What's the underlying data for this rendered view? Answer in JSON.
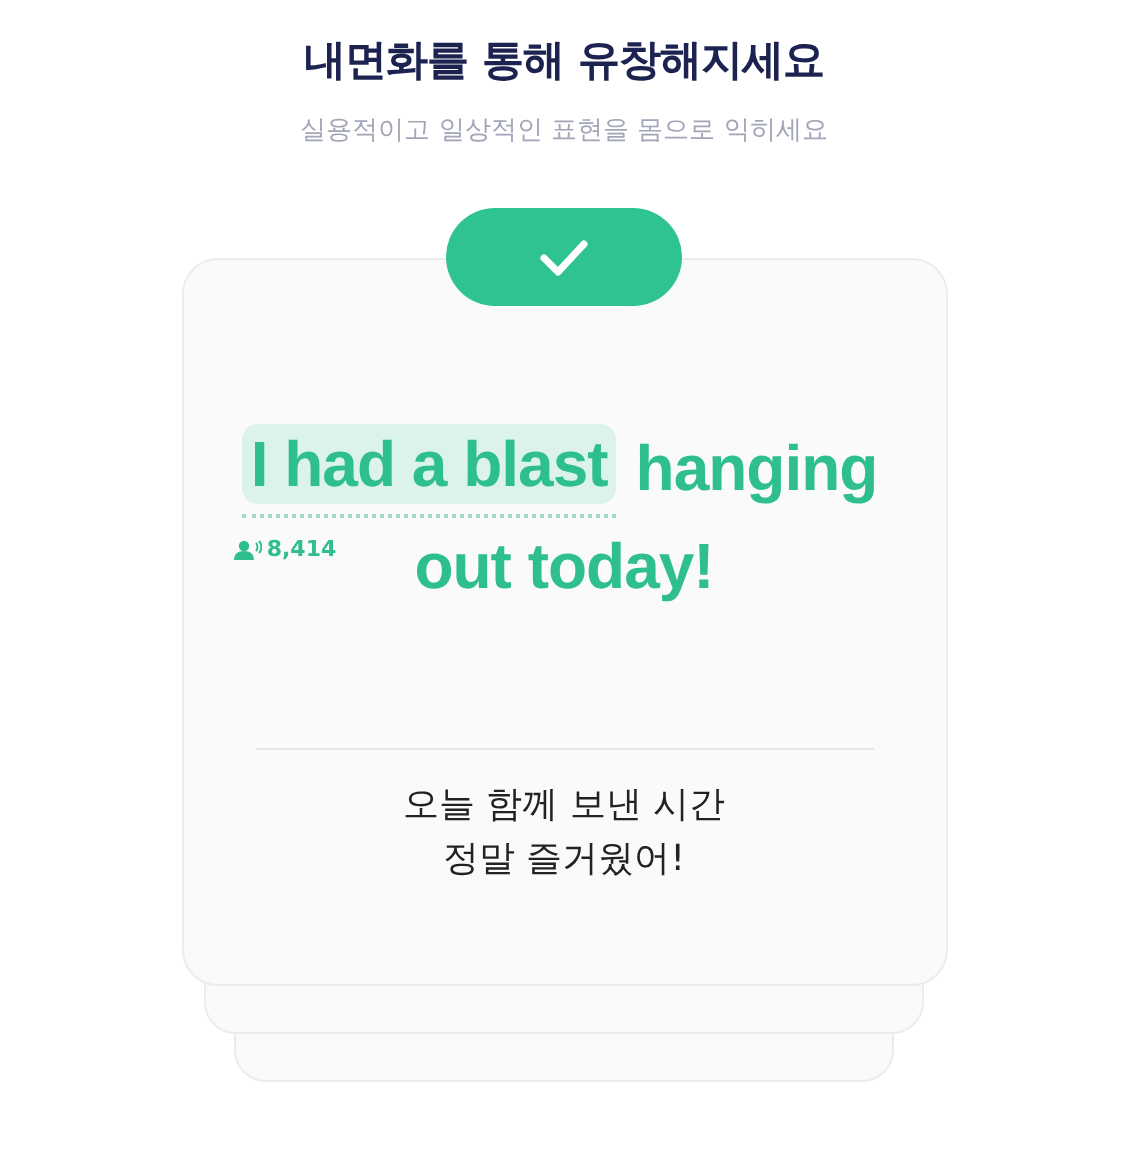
{
  "header": {
    "title": "내면화를 통해 유창해지세요",
    "subtitle": "실용적이고 일상적인 표현을 몸으로 익히세요"
  },
  "card": {
    "completed": true,
    "phrase_lines": [
      [
        {
          "text": "I had a blast",
          "highlighted": true,
          "learners": "8,414"
        },
        {
          "text": "hanging",
          "highlighted": false
        }
      ],
      [
        {
          "text": "out today!",
          "highlighted": false
        }
      ]
    ],
    "translation": [
      "오늘 함께 보낸 시간",
      "정말 즐거웠어!"
    ]
  }
}
